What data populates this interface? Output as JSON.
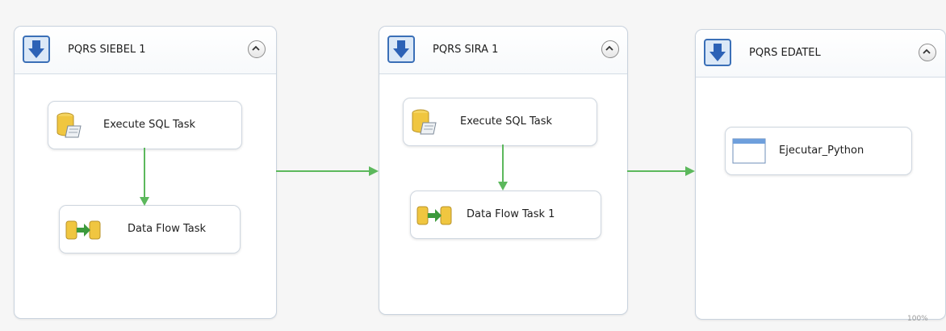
{
  "containers": [
    {
      "title": "PQRS SIEBEL 1",
      "collapse_icon": "chevron-up-icon",
      "tasks": [
        {
          "label": "Execute SQL Task",
          "icon": "execute-sql-icon"
        },
        {
          "label": "Data Flow Task",
          "icon": "data-flow-icon"
        }
      ]
    },
    {
      "title": "PQRS SIRA 1",
      "collapse_icon": "chevron-up-icon",
      "tasks": [
        {
          "label": "Execute SQL Task",
          "icon": "execute-sql-icon"
        },
        {
          "label": "Data Flow Task 1",
          "icon": "data-flow-icon"
        }
      ]
    },
    {
      "title": "PQRS EDATEL",
      "collapse_icon": "chevron-up-icon",
      "tasks": [
        {
          "label": "Ejecutar_Python",
          "icon": "process-task-icon"
        }
      ]
    }
  ],
  "precedence_color": "#5cb85c",
  "zoom_label": "100%"
}
